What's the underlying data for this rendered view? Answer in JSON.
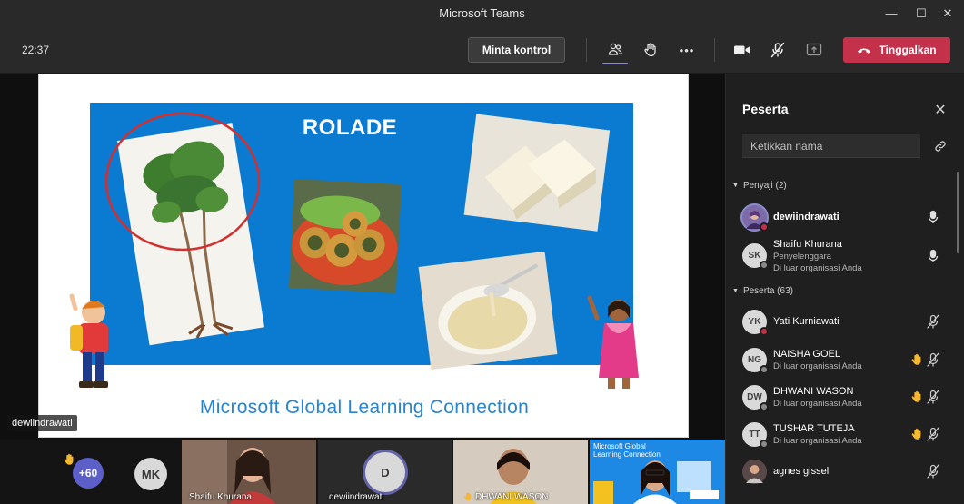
{
  "window": {
    "title": "Microsoft Teams",
    "minimize_glyph": "—",
    "maximize_glyph": "☐",
    "close_glyph": "✕"
  },
  "toolbar": {
    "clock": "22:37",
    "request_control_label": "Minta kontrol",
    "more_glyph": "•••",
    "leave_label": "Tinggalkan",
    "icons": [
      "people-icon",
      "raise-hand-icon",
      "more-options-icon",
      "camera-icon",
      "mic-off-icon",
      "share-screen-icon",
      "phone-hangup-icon"
    ]
  },
  "slide": {
    "title": "ROLADE",
    "footer": "Microsoft Global Learning Connection",
    "colors": {
      "blue": "#0b7bd1",
      "footer": "#2a84cc",
      "circle": "#d32f2f"
    }
  },
  "stage": {
    "presenter_label": "dewiindrawati"
  },
  "strip": {
    "overflow_count": "+60",
    "mk_initials": "MK",
    "d_initials": "D",
    "tiles": [
      {
        "name": "Shaifu Khurana"
      },
      {
        "name": "dewiindrawati"
      },
      {
        "name": "DHWANI WASON"
      },
      {
        "title": "Microsoft Global Learning Connection"
      }
    ]
  },
  "panel": {
    "title": "Peserta",
    "close_glyph": "✕",
    "search_placeholder": "Ketikkan nama",
    "presenters_header": "Penyaji (2)",
    "attendees_header": "Peserta (63)",
    "presenters": [
      {
        "name": "dewiindrawati",
        "initials": "",
        "subtitle1": "",
        "subtitle2": ""
      },
      {
        "name": "Shaifu Khurana",
        "initials": "SK",
        "subtitle1": "Penyelenggara",
        "subtitle2": "Di luar organisasi Anda"
      }
    ],
    "attendees": [
      {
        "name": "Yati Kurniawati",
        "initials": "YK",
        "subtitle": "",
        "hand_raised": false
      },
      {
        "name": "NAISHA GOEL",
        "initials": "NG",
        "subtitle": "Di luar organisasi Anda",
        "hand_raised": true
      },
      {
        "name": "DHWANI WASON",
        "initials": "DW",
        "subtitle": "Di luar organisasi Anda",
        "hand_raised": true
      },
      {
        "name": "TUSHAR TUTEJA",
        "initials": "TT",
        "subtitle": "Di luar organisasi Anda",
        "hand_raised": true
      },
      {
        "name": "agnes gissel",
        "initials": "",
        "subtitle": "",
        "hand_raised": false
      }
    ],
    "colors": {
      "accent": "#8b8cc7",
      "hand": "#f5b82e",
      "leave": "#c4314b"
    }
  }
}
